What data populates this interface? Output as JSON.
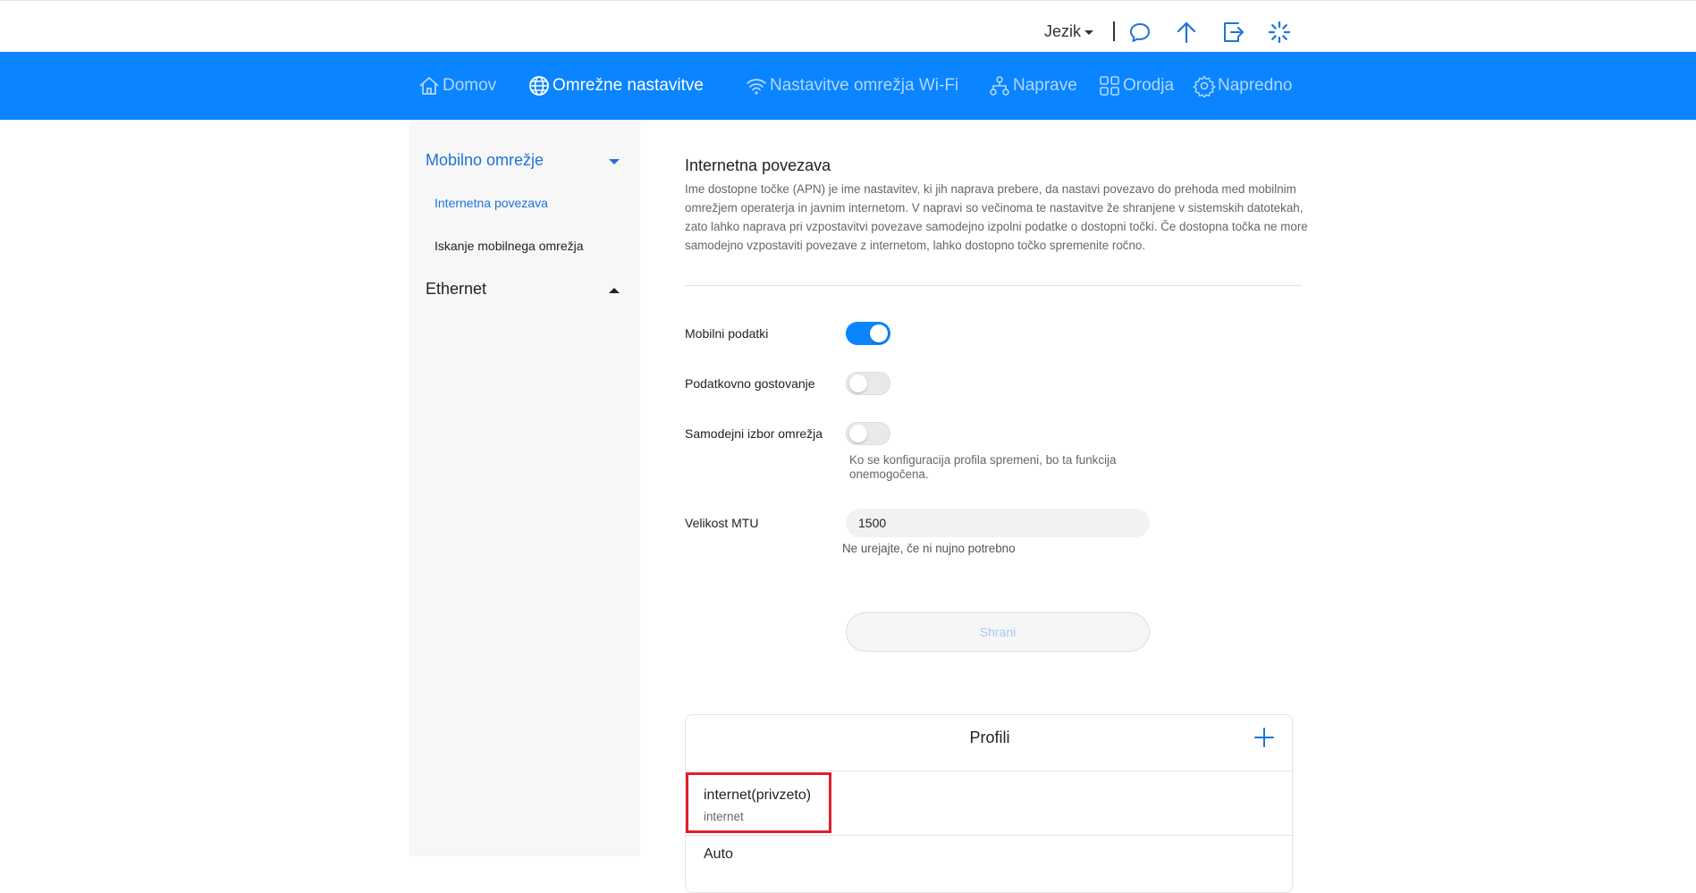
{
  "header": {
    "language_label": "Jezik",
    "icons": [
      "message-icon",
      "update-icon",
      "logout-icon",
      "loading-icon"
    ]
  },
  "nav": {
    "items": [
      {
        "label": "Domov",
        "icon": "home-icon"
      },
      {
        "label": "Omrežne nastavitve",
        "icon": "globe-icon"
      },
      {
        "label": "Nastavitve omrežja Wi-Fi",
        "icon": "wifi-icon"
      },
      {
        "label": "Naprave",
        "icon": "devices-icon"
      },
      {
        "label": "Orodja",
        "icon": "tools-icon"
      },
      {
        "label": "Napredno",
        "icon": "settings-icon"
      }
    ],
    "active_index": 1
  },
  "sidebar": {
    "group1": "Mobilno omrežje",
    "sub1": "Internetna povezava",
    "sub2": "Iskanje mobilnega omrežja",
    "group2": "Ethernet"
  },
  "main": {
    "title": "Internetna povezava",
    "description": "Ime dostopne točke (APN) je ime nastavitev, ki jih naprava prebere, da nastavi povezavo do prehoda med mobilnim omrežjem operaterja in javnim internetom. V napravi so večinoma te nastavitve že shranjene v sistemskih datotekah, zato lahko naprava pri vzpostavitvi povezave samodejno izpolni podatke o dostopni točki. Če dostopna točka ne more samodejno vzpostaviti povezave z internetom, lahko dostopno točko spremenite ročno.",
    "mobile_data_label": "Mobilni podatki",
    "mobile_data_on": true,
    "roaming_label": "Podatkovno gostovanje",
    "roaming_on": false,
    "auto_network_label": "Samodejni izbor omrežja",
    "auto_network_on": false,
    "auto_network_hint": "Ko se konfiguracija profila spremeni, bo ta funkcija onemogočena.",
    "mtu_label": "Velikost MTU",
    "mtu_value": "1500",
    "mtu_hint": "Ne urejajte, če ni nujno potrebno",
    "save_label": "Shrani"
  },
  "profiles": {
    "title": "Profili",
    "items": [
      {
        "name": "internet(privzeto)",
        "apn": "internet"
      },
      {
        "name": "Auto",
        "apn": ""
      }
    ]
  },
  "colors": {
    "nav_bg": "#0a84ff",
    "accent": "#1e73d8",
    "highlight": "#e0202a"
  }
}
